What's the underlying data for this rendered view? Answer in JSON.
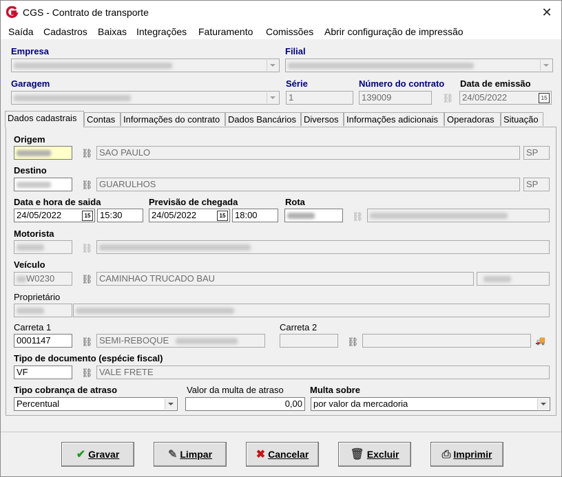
{
  "window": {
    "title": "CGS - Contrato de transporte",
    "close_label": "✕"
  },
  "menu": [
    "Saída",
    "Cadastros",
    "Baixas",
    "Integrações",
    "Faturamento",
    "Comissões",
    "Abrir configuração de impressão"
  ],
  "header": {
    "empresa_label": "Empresa",
    "filial_label": "Filial",
    "garagem_label": "Garagem",
    "serie_label": "Série",
    "serie_value": "1",
    "numero_label": "Número do contrato",
    "numero_value": "139009",
    "emissao_label": "Data de emissão",
    "emissao_value": "24/05/2022"
  },
  "tabs": [
    "Dados cadastrais",
    "Contas",
    "Informações do contrato",
    "Dados Bancários",
    "Diversos",
    "Informações adicionais",
    "Operadoras",
    "Situação"
  ],
  "form": {
    "origem_label": "Origem",
    "origem_city": "SAO PAULO",
    "origem_uf": "SP",
    "destino_label": "Destino",
    "destino_city": "GUARULHOS",
    "destino_uf": "SP",
    "saida_label": "Data e hora de saida",
    "saida_date": "24/05/2022",
    "saida_time": "15:30",
    "chegada_label": "Previsão de chegada",
    "chegada_date": "24/05/2022",
    "chegada_time": "18:00",
    "rota_label": "Rota",
    "motorista_label": "Motorista",
    "veiculo_label": "Veículo",
    "veiculo_plate": "W0230",
    "veiculo_desc": "CAMINHAO TRUCADO BAU",
    "proprietario_label": "Proprietário",
    "carreta1_label": "Carreta 1",
    "carreta1_code": "0001147",
    "carreta1_desc": "SEMI-REBOQUE",
    "carreta2_label": "Carreta 2",
    "tipo_doc_label": "Tipo de documento (espécie fiscal)",
    "tipo_doc_code": "VF",
    "tipo_doc_desc": "VALE FRETE",
    "cobranca_label": "Tipo cobrança de atraso",
    "cobranca_value": "Percentual",
    "multa_valor_label": "Valor da multa de atraso",
    "multa_valor": "0,00",
    "multa_sobre_label": "Multa sobre",
    "multa_sobre_value": "por valor da mercadoria"
  },
  "buttons": {
    "gravar": "Gravar",
    "limpar": "Limpar",
    "cancelar": "Cancelar",
    "excluir": "Excluir",
    "imprimir": "Imprimir"
  },
  "colors": {
    "label_blue": "#00007b",
    "app_icon_red": "#c8102e"
  }
}
